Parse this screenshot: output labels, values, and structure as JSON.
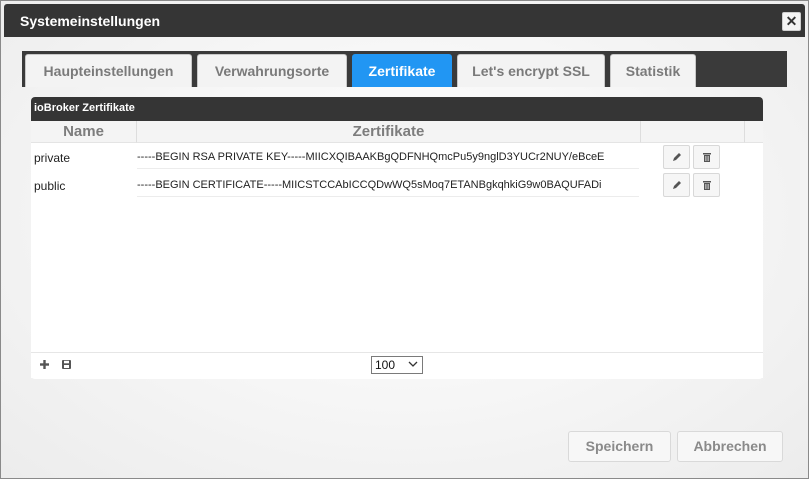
{
  "window": {
    "title": "Systemeinstellungen"
  },
  "tabs": [
    {
      "label": "Haupteinstellungen"
    },
    {
      "label": "Verwahrungsorte"
    },
    {
      "label": "Zertifikate"
    },
    {
      "label": "Let's encrypt SSL"
    },
    {
      "label": "Statistik"
    }
  ],
  "active_tab": "Zertifikate",
  "panel": {
    "title": "ioBroker Zertifikate",
    "columns": [
      "Name",
      "Zertifikate"
    ],
    "rows": [
      {
        "name": "private",
        "certificate": "-----BEGIN RSA PRIVATE KEY-----MIICXQIBAAKBgQDFNHQmcPu5y9nglD3YUCr2NUY/eBceE"
      },
      {
        "name": "public",
        "certificate": "-----BEGIN CERTIFICATE-----MIICSTCCAbICCQDwWQ5sMoq7ETANBgkqhkiG9w0BAQUFADi"
      }
    ],
    "page_size": "100"
  },
  "buttons": {
    "save": "Speichern",
    "cancel": "Abbrechen"
  },
  "colors": {
    "accent": "#2196f3",
    "header": "#353535"
  }
}
